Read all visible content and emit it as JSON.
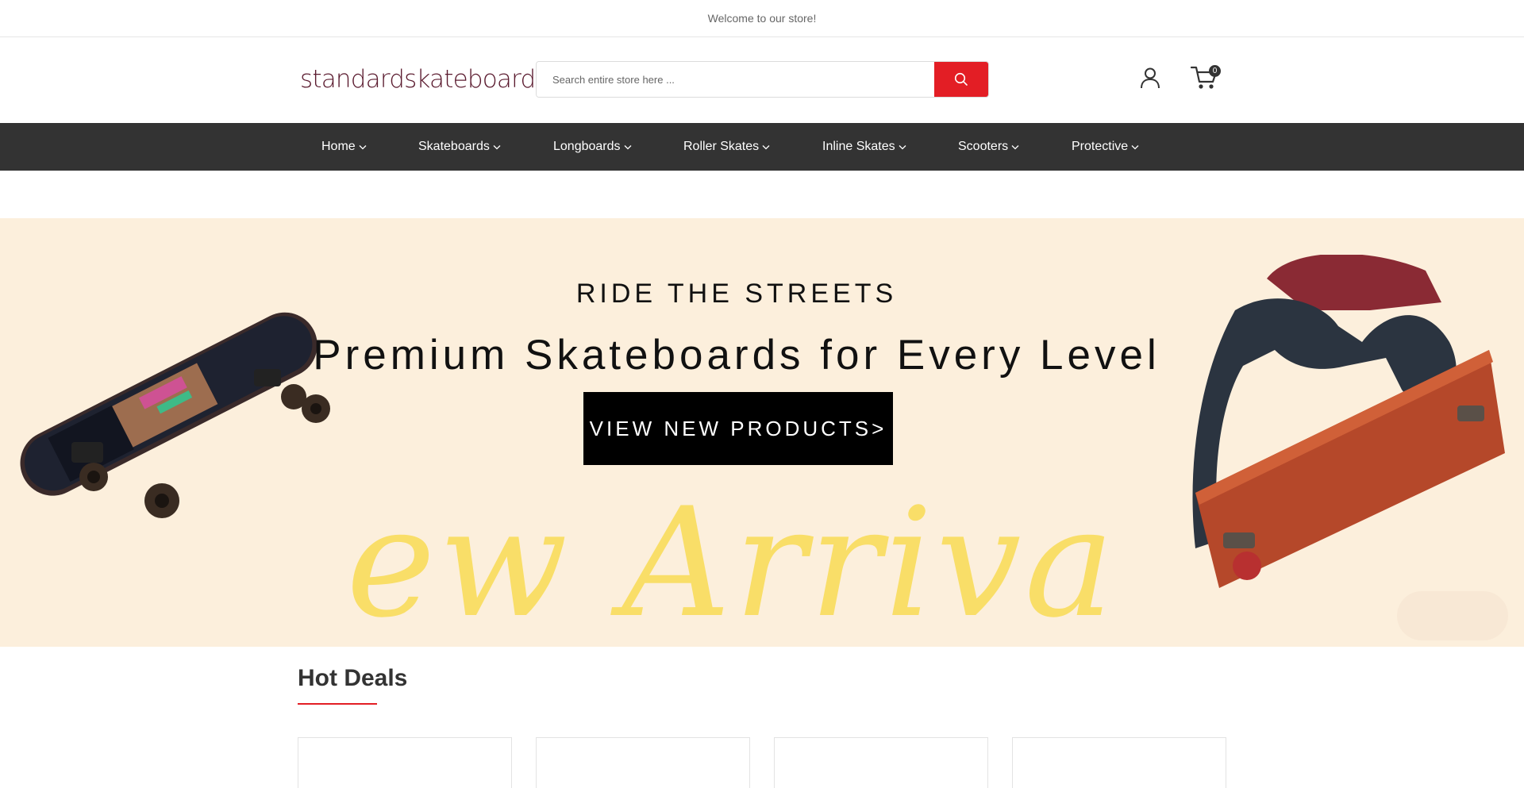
{
  "topbar": {
    "welcome": "Welcome to our store!"
  },
  "header": {
    "logo": "standardskateboard",
    "search_placeholder": "Search entire store here ...",
    "search_button_icon": "search-icon",
    "account_icon": "user-icon",
    "cart_icon": "cart-icon",
    "cart_count": "0"
  },
  "nav": {
    "items": [
      {
        "label": "Home"
      },
      {
        "label": "Skateboards"
      },
      {
        "label": "Longboards"
      },
      {
        "label": "Roller Skates"
      },
      {
        "label": "Inline Skates"
      },
      {
        "label": "Scooters"
      },
      {
        "label": "Protective"
      }
    ]
  },
  "hero": {
    "eyebrow": "RIDE THE STREETS",
    "title": "Premium Skateboards for Every Level",
    "button": "VIEW NEW PRODUCTS>",
    "script_text": "New Arrivals"
  },
  "hot_deals": {
    "title": "Hot Deals"
  },
  "colors": {
    "accent": "#e31e25",
    "nav_bg": "#333333",
    "hero_bg": "#fcefdc",
    "logo": "#5a1a2e",
    "script_text": "#f9dd5c"
  }
}
